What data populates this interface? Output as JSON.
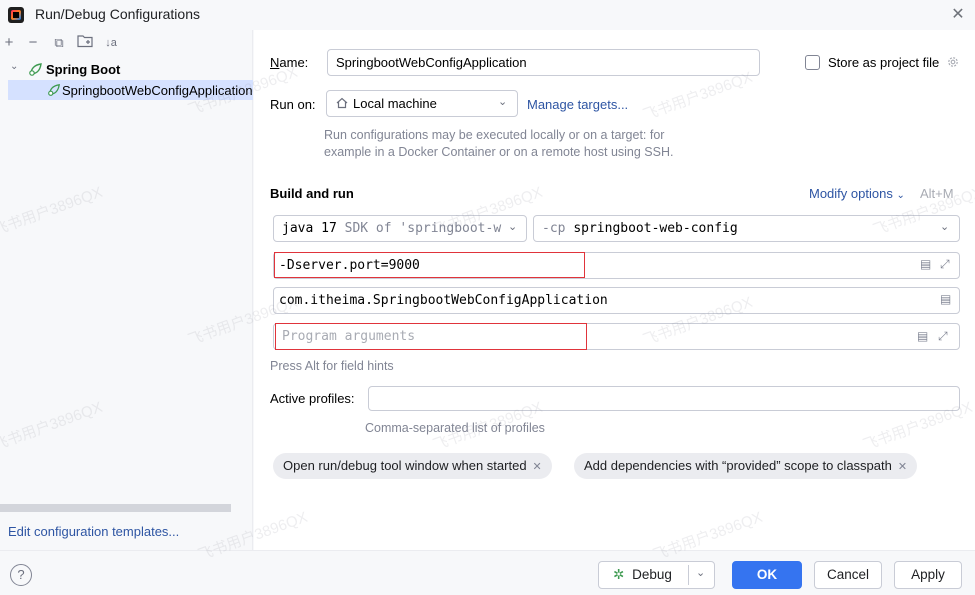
{
  "window": {
    "title": "Run/Debug Configurations"
  },
  "toolbar": {
    "add": "+",
    "remove": "−",
    "copy": "⧉",
    "folder": "📁",
    "sort": "↓a"
  },
  "tree": {
    "root_label": "Spring Boot",
    "child_label": "SpringbootWebConfigApplication"
  },
  "left_footer": {
    "edit_templates": "Edit configuration templates..."
  },
  "form": {
    "name_label_prefix": "N",
    "name_label_rest": "ame:",
    "name_value": "SpringbootWebConfigApplication",
    "store_label": "Store as project file",
    "run_on_label": "Run on:",
    "run_on_value": "Local machine",
    "manage_targets": "Manage targets...",
    "run_on_hint_1": "Run configurations may be executed locally or on a target: for",
    "run_on_hint_2": "example in a Docker Container or on a remote host using SSH.",
    "build_run_title": "Build and run",
    "modify_options": "Modify options",
    "modify_shortcut": "Alt+M",
    "sdk_value_main": "java 17",
    "sdk_value_rest": "SDK of 'springboot-w",
    "cp_prefix": "-cp",
    "cp_value": "springboot-web-config",
    "vm_options": "-Dserver.port=9000",
    "main_class": "com.itheima.SpringbootWebConfigApplication",
    "program_args_placeholder": "Program arguments",
    "field_hints": "Press Alt for field hints",
    "active_profiles_label": "Active profiles:",
    "active_profiles_value": "",
    "profiles_hint": "Comma-separated list of profiles",
    "chip_1": "Open run/debug tool window when started",
    "chip_2": "Add dependencies with “provided” scope to classpath"
  },
  "buttons": {
    "help": "?",
    "debug": "Debug",
    "ok": "OK",
    "cancel": "Cancel",
    "apply": "Apply"
  },
  "watermark": {
    "text": "飞书用户3896QX"
  },
  "colors": {
    "accent": "#3574f0",
    "highlight_box": "#e0343b",
    "link": "#2e55a3",
    "selection": "#d5e1ff"
  }
}
